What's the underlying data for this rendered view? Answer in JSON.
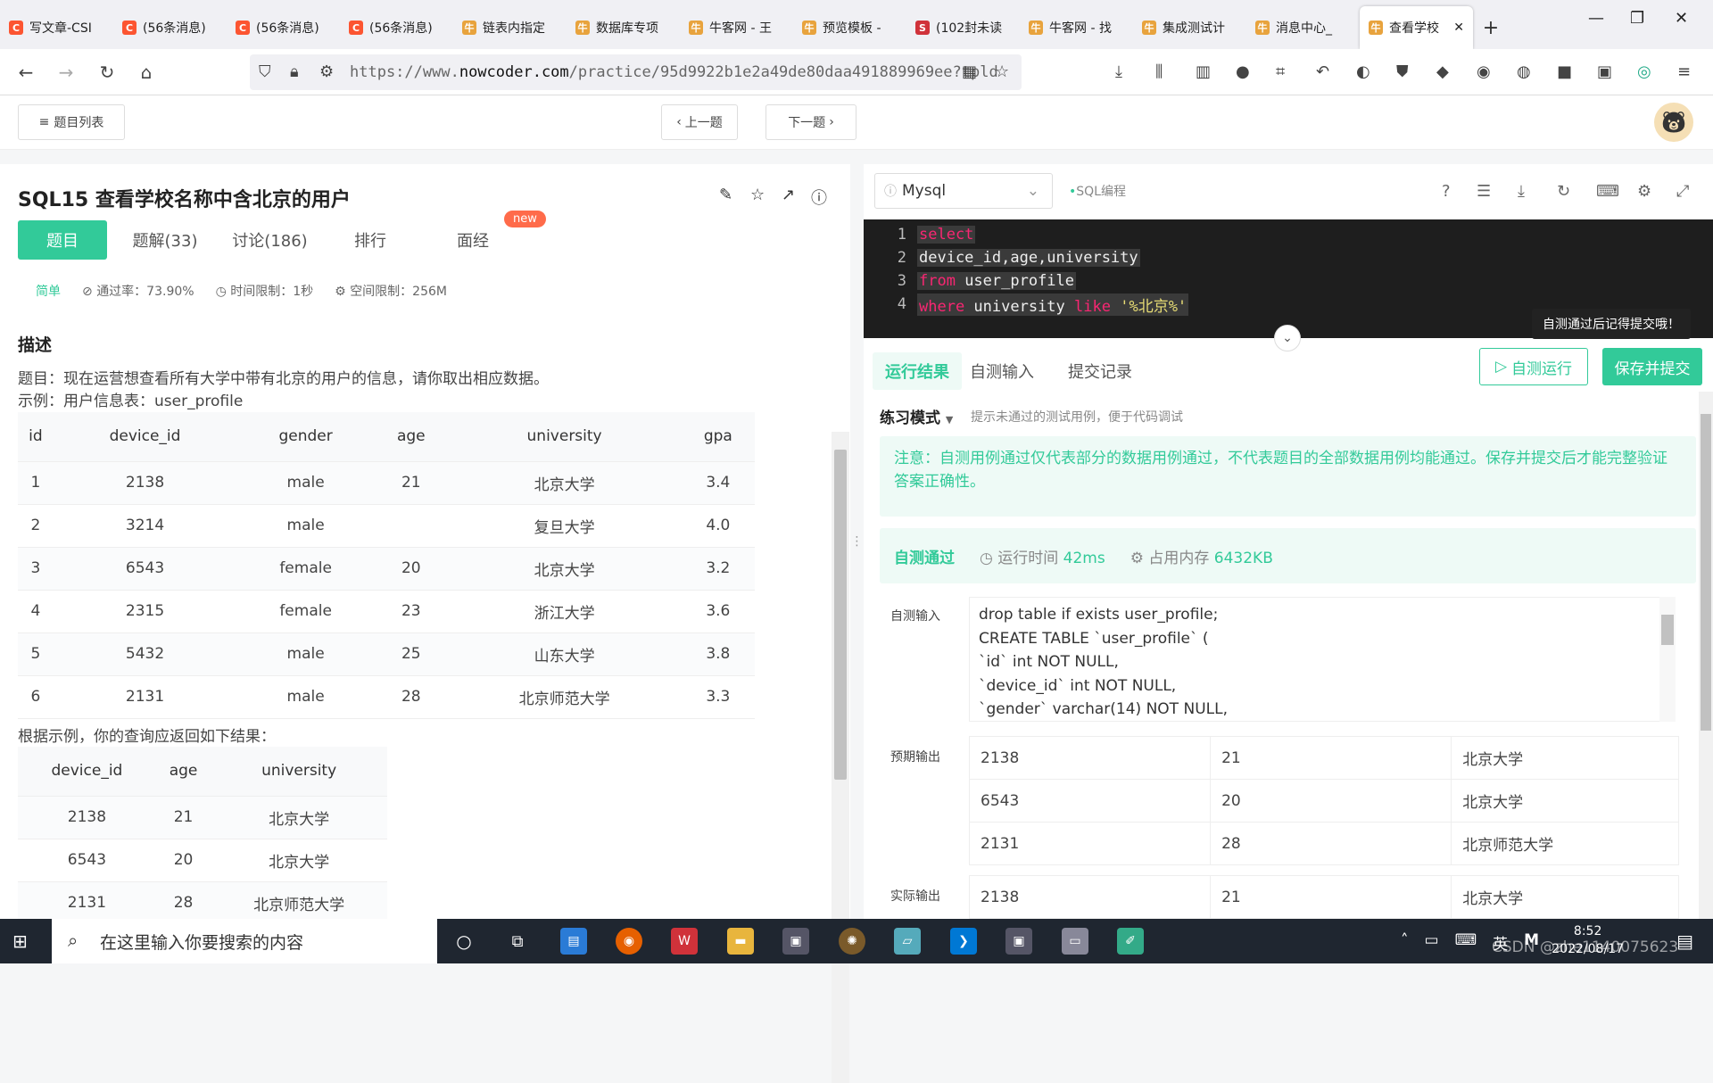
{
  "browser": {
    "tabs": [
      {
        "label": "写文章-CSI",
        "color": "#fc5531",
        "glyph": "C"
      },
      {
        "label": "(56条消息)",
        "color": "#fc5531",
        "glyph": "C"
      },
      {
        "label": "(56条消息)",
        "color": "#fc5531",
        "glyph": "C"
      },
      {
        "label": "(56条消息)",
        "color": "#fc5531",
        "glyph": "C"
      },
      {
        "label": "链表内指定",
        "color": "#e8a33d",
        "glyph": "牛"
      },
      {
        "label": "数据库专项",
        "color": "#e8a33d",
        "glyph": "牛"
      },
      {
        "label": "牛客网 - 王",
        "color": "#e8a33d",
        "glyph": "牛"
      },
      {
        "label": "预览模板 -",
        "color": "#e8a33d",
        "glyph": "牛"
      },
      {
        "label": "(102封未读",
        "color": "#d0323a",
        "glyph": "S"
      },
      {
        "label": "牛客网 - 找",
        "color": "#e8a33d",
        "glyph": "牛"
      },
      {
        "label": "集成测试计",
        "color": "#e8a33d",
        "glyph": "牛"
      },
      {
        "label": "消息中心_",
        "color": "#e8a33d",
        "glyph": "牛"
      },
      {
        "label": "查看学校",
        "color": "#e8a33d",
        "glyph": "牛",
        "active": true
      }
    ],
    "new_tab": "+",
    "url": "https://www.nowcoder.com/practice/95d9922b1e2a49de80daa491889969ee?tpId",
    "url_prefix": "https://www.",
    "url_domain": "nowcoder.com",
    "url_rest": "/practice/95d9922b1e2a49de80daa491889969ee?tpld"
  },
  "page_top": {
    "list_label": "题目列表",
    "prev_label": "上一题",
    "next_label": "下一题"
  },
  "problem": {
    "title": "SQL15  查看学校名称中含北京的用户",
    "tabs": [
      {
        "label": "题目",
        "active": true
      },
      {
        "label": "题解(33)"
      },
      {
        "label": "讨论(186)"
      },
      {
        "label": "排行"
      },
      {
        "label": "面经"
      }
    ],
    "new_badge": "new",
    "difficulty": "简单",
    "pass_rate": "通过率：73.90%",
    "time_limit": "时间限制：1秒",
    "space_limit": "空间限制：256M",
    "desc_heading": "描述",
    "desc_line1": "题目：现在运营想查看所有大学中带有北京的用户的信息，请你取出相应数据。",
    "desc_line2": "示例：用户信息表：user_profile",
    "table1": {
      "headers": [
        "id",
        "device_id",
        "gender",
        "age",
        "university",
        "gpa"
      ],
      "rows": [
        [
          "1",
          "2138",
          "male",
          "21",
          "北京大学",
          "3.4"
        ],
        [
          "2",
          "3214",
          "male",
          "",
          "复旦大学",
          "4.0"
        ],
        [
          "3",
          "6543",
          "female",
          "20",
          "北京大学",
          "3.2"
        ],
        [
          "4",
          "2315",
          "female",
          "23",
          "浙江大学",
          "3.6"
        ],
        [
          "5",
          "5432",
          "male",
          "25",
          "山东大学",
          "3.8"
        ],
        [
          "6",
          "2131",
          "male",
          "28",
          "北京师范大学",
          "3.3"
        ]
      ]
    },
    "result_caption": "根据示例，你的查询应返回如下结果：",
    "table2": {
      "headers": [
        "device_id",
        "age",
        "university"
      ],
      "rows": [
        [
          "2138",
          "21",
          "北京大学"
        ],
        [
          "6543",
          "20",
          "北京大学"
        ],
        [
          "2131",
          "28",
          "北京师范大学"
        ]
      ]
    }
  },
  "editor": {
    "language": "Mysql",
    "tag": "SQL编程",
    "lines": [
      {
        "n": "1",
        "parts": [
          {
            "t": "select",
            "k": "kw"
          }
        ]
      },
      {
        "n": "2",
        "parts": [
          {
            "t": "device_id,age,university",
            "k": "cd"
          }
        ]
      },
      {
        "n": "3",
        "parts": [
          {
            "t": "from",
            "k": "kw"
          },
          {
            "t": " user_profile",
            "k": "cd"
          }
        ]
      },
      {
        "n": "4",
        "parts": [
          {
            "t": "where",
            "k": "kw"
          },
          {
            "t": " university ",
            "k": "cd"
          },
          {
            "t": "like",
            "k": "kw"
          },
          {
            "t": " ",
            "k": "cd"
          },
          {
            "t": "'%北京%'",
            "k": "str"
          }
        ]
      }
    ],
    "tooltip": "自测通过后记得提交哦！"
  },
  "results": {
    "tabs": [
      {
        "label": "运行结果",
        "active": true
      },
      {
        "label": "自测输入"
      },
      {
        "label": "提交记录"
      }
    ],
    "run_label": "自测运行",
    "submit_label": "保存并提交",
    "mode_label": "练习模式",
    "mode_hint": "提示未通过的测试用例，便于代码调试",
    "notice": "注意：自测用例通过仅代表部分的数据用例通过，不代表题目的全部数据用例均能通过。保存并提交后才能完整验证答案正确性。",
    "pass_label": "自测通过",
    "run_time_label": "运行时间",
    "run_time": "42ms",
    "mem_label": "占用内存",
    "mem": "6432KB",
    "input_label": "自测输入",
    "input_lines": [
      "drop table if exists user_profile;",
      "CREATE TABLE `user_profile` (",
      "`id` int NOT NULL,",
      "`device_id` int NOT NULL,",
      "`gender` varchar(14) NOT NULL,"
    ],
    "expected_label": "预期输出",
    "expected_rows": [
      [
        "2138",
        "21",
        "北京大学"
      ],
      [
        "6543",
        "20",
        "北京大学"
      ],
      [
        "2131",
        "28",
        "北京师范大学"
      ]
    ],
    "actual_label": "实际输出",
    "actual_rows": [
      [
        "2138",
        "21",
        "北京大学"
      ]
    ]
  },
  "taskbar": {
    "search_placeholder": "在这里输入你要搜索的内容",
    "time": "8:52",
    "date": "2022/08/17",
    "ime": "英",
    "watermark": "CSDN @zhe1140075623"
  }
}
